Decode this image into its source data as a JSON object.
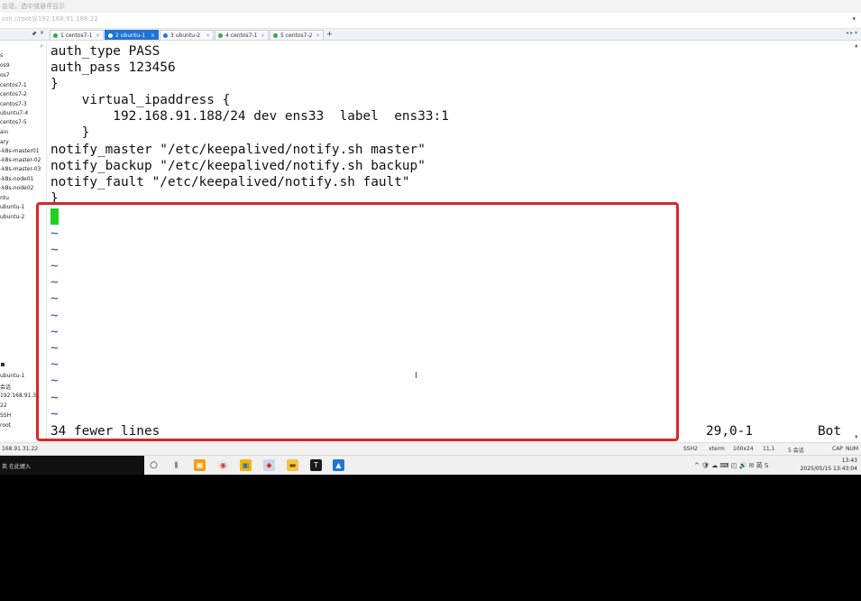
{
  "window": {
    "hint": "会话，选中或悬停显示",
    "address": "ssh://root@192.168.91.188:22"
  },
  "sidebar_header": {
    "pin": "🖈",
    "close": "×"
  },
  "tabs": [
    {
      "label": "1 centos7-1",
      "active": false
    },
    {
      "label": "2 ubuntu-1",
      "active": true
    },
    {
      "label": "3 ubuntu-2",
      "active": false
    },
    {
      "label": "4 centos7-1",
      "active": false
    },
    {
      "label": "5 centos7-2",
      "active": false
    }
  ],
  "tab_add": "+",
  "tab_nav": "◂ ▸ ▾",
  "sidebar": {
    "items": [
      "s",
      "os9",
      "os7",
      "centos7-1",
      "centos7-2",
      "centos7-3",
      "ubuntu7-4",
      "centos7-5",
      "ain",
      "ary",
      "-k8s-master01",
      "-k8s-master-02",
      "-k8s-master-03",
      "-k8s-node01",
      "-k8s-node02",
      "ntu",
      "ubuntu-1",
      "ubuntu-2"
    ],
    "props": [
      "ubuntu-1",
      "会话",
      "192.168.91.31",
      "22",
      "SSH",
      "root"
    ]
  },
  "terminal": {
    "lines": [
      "auth_type PASS",
      "auth_pass 123456",
      "}",
      "    virtual_ipaddress {",
      "        192.168.91.188/24 dev ens33  label  ens33:1",
      "    }",
      "notify_master \"/etc/keepalived/notify.sh master\"",
      "notify_backup \"/etc/keepalived/notify.sh backup\"",
      "notify_fault \"/etc/keepalived/notify.sh fault\"",
      "}"
    ],
    "tildes": [
      "~",
      "~",
      "~",
      "~",
      "~",
      "~",
      "~",
      "~",
      "~",
      "~",
      "~",
      "~"
    ],
    "status_message": "34 fewer lines",
    "cursor_pos": "29,0-1",
    "scroll_pos": "Bot",
    "mouse": "I"
  },
  "statusbar": {
    "host": "168.91.31.22",
    "proto": "SSH2",
    "term": "xterm",
    "size": "100x24",
    "pos": "11,1",
    "sessions": "5 会话",
    "caps": "CAP",
    "num": "NUM"
  },
  "taskbar": {
    "ime": "英 在此键入",
    "time": "13:43",
    "date": "2025/05/15 13:43:04",
    "tray": "^ 🛡 ☁ ⌨ ◰ 🔊 ✉ 英 S"
  },
  "colors": {
    "tab_active": "#1f74d6",
    "cursor": "#22d022",
    "tilde": "#2b49b5",
    "highlight": "#e02424"
  }
}
